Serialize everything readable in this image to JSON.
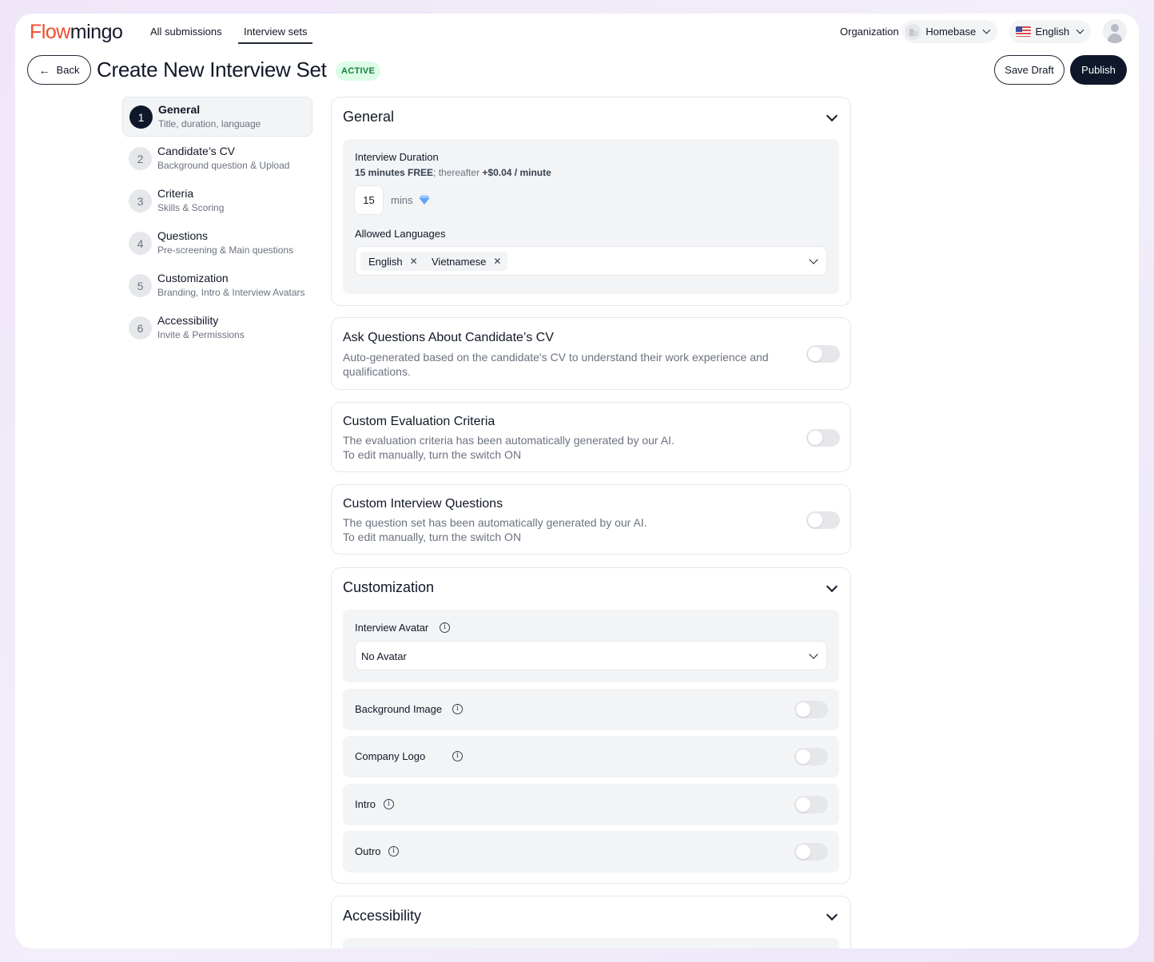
{
  "app": {
    "logo_part1": "Flow",
    "logo_part2": "mingo"
  },
  "nav": {
    "all_submissions": "All submissions",
    "interview_sets": "Interview sets",
    "organization_label": "Organization",
    "organization_value": "Homebase",
    "language_value": "English"
  },
  "header": {
    "back_label": "Back",
    "title": "Create New Interview Set",
    "status": "ACTIVE",
    "save_draft_label": "Save Draft",
    "publish_label": "Publish"
  },
  "steps": [
    {
      "num": "1",
      "title": "General",
      "sub": "Title, duration, language"
    },
    {
      "num": "2",
      "title": "Candidate’s CV",
      "sub": "Background question & Upload"
    },
    {
      "num": "3",
      "title": "Criteria",
      "sub": "Skills & Scoring"
    },
    {
      "num": "4",
      "title": "Questions",
      "sub": "Pre-screening & Main questions"
    },
    {
      "num": "5",
      "title": "Customization",
      "sub": "Branding, Intro & Interview Avatars"
    },
    {
      "num": "6",
      "title": "Accessibility",
      "sub": "Invite & Permissions"
    }
  ],
  "general": {
    "title": "General",
    "duration_label": "Interview Duration",
    "duration_note_free": "15 minutes FREE",
    "duration_note_mid": "; thereafter ",
    "duration_note_price": "+$0.04 / minute",
    "duration_value": "15",
    "duration_unit": "mins",
    "languages_label": "Allowed Languages",
    "languages": [
      "English",
      "Vietnamese"
    ]
  },
  "cv_section": {
    "title": "Ask Questions About Candidate’s CV",
    "desc": "Auto-generated based on the candidate's CV to understand their work experience and qualifications."
  },
  "criteria_section": {
    "title": "Custom Evaluation Criteria",
    "desc_line1": "The evaluation criteria has been automatically generated by our AI.",
    "desc_line2": "To edit manually, turn the switch ON"
  },
  "questions_section": {
    "title": "Custom Interview Questions",
    "desc_line1": "The question set has been automatically generated by our AI.",
    "desc_line2": "To edit manually, turn the switch ON"
  },
  "customization": {
    "title": "Customization",
    "avatar_label": "Interview Avatar",
    "avatar_value": "No Avatar",
    "background_label": "Background Image",
    "logo_label": "Company Logo",
    "intro_label": "Intro",
    "outro_label": "Outro"
  },
  "accessibility": {
    "title": "Accessibility"
  },
  "colors": {
    "brand_orange": "#f04d2c",
    "primary_dark": "#0f172a",
    "active_badge_bg": "#dcfce7",
    "active_badge_text": "#15803d"
  }
}
